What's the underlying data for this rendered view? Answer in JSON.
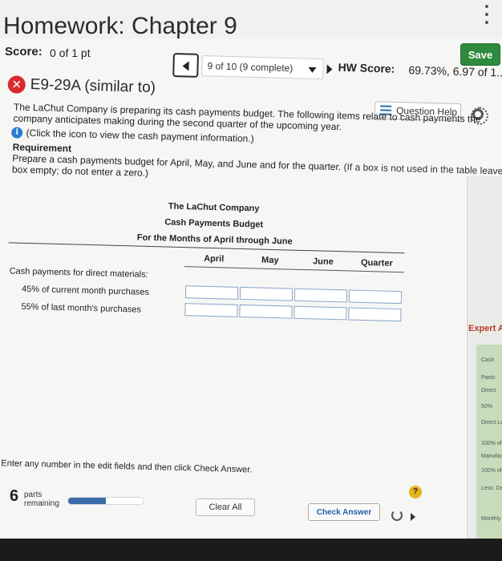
{
  "header": {
    "title": "Homework: Chapter 9"
  },
  "score": {
    "label": "Score:",
    "value": "0 of 1 pt",
    "save_label": "Save"
  },
  "navigation": {
    "question_selector": "9 of 10 (9 complete)",
    "hw_score_label": "HW Score:",
    "hw_score_value": "69.73%, 6.97 of 1..."
  },
  "exercise": {
    "title": "E9-29A (similar to)",
    "status_icon": "x-circle-icon",
    "question_help_label": "Question Help",
    "intro_line_1": "The LaChut Company is preparing its cash payments budget. The following items relate to cash payments the",
    "intro_line_2": "company anticipates making during the second quarter of the upcoming year.",
    "info_link": "(Click the icon to view the cash payment information.)",
    "requirement_heading": "Requirement",
    "requirement_text": "Prepare a cash payments budget for April, May, and June and for the quarter.",
    "requirement_note": "(If a box is not used in the table leave the",
    "requirement_note_2": "box empty; do not enter a zero.)"
  },
  "table": {
    "company": "The LaChut Company",
    "budget_title": "Cash Payments Budget",
    "period": "For the Months of April through June",
    "columns": [
      "April",
      "May",
      "June",
      "Quarter"
    ],
    "rows": [
      "Cash payments for direct materials:",
      "45% of current month purchases",
      "55% of last month's purchases"
    ]
  },
  "footer": {
    "instructions": "Enter any number in the edit fields and then click Check Answer.",
    "parts_count": "6",
    "parts_label": "parts remaining",
    "progress_fraction": 0.5,
    "clear_all_label": "Clear All",
    "check_answer_label": "Check Answer"
  },
  "side_panel": {
    "expert_label": "Expert A",
    "snippets": [
      "Cash",
      "Partic",
      "Direct",
      "50%",
      "Direct Lab",
      "100% of",
      "Manufactu",
      "100% of",
      "Less: Depre",
      "Monthly Opera"
    ]
  },
  "colors": {
    "save_button": "#2e8a3c",
    "status_error": "#d8292f",
    "info_icon": "#2a7bd0",
    "progress_fill": "#3c6ca8",
    "help_icon": "#e4b21b"
  }
}
